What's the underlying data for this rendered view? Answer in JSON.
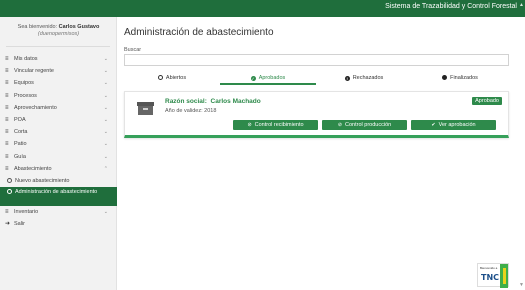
{
  "header": {
    "system_title": "Sistema de Trazabilidad y Control Forestal"
  },
  "sidebar": {
    "welcome_prefix": "Sea bienvenido: ",
    "user_name": "Carlos Gustavo",
    "username": "(duenopermisos)",
    "items": [
      {
        "label": "Mis datos"
      },
      {
        "label": "Vincular regente"
      },
      {
        "label": "Equipos"
      },
      {
        "label": "Procesos"
      },
      {
        "label": "Aprovechamiento"
      },
      {
        "label": "POA"
      },
      {
        "label": "Corta"
      },
      {
        "label": "Patio"
      },
      {
        "label": "Guía"
      },
      {
        "label": "Abastecimiento"
      },
      {
        "label": "Nuevo abastecimiento"
      },
      {
        "label": "Administración de abastecimiento"
      },
      {
        "label": "Inventario"
      },
      {
        "label": "Salir"
      }
    ]
  },
  "main": {
    "title": "Administración de abastecimiento",
    "search_label": "Buscar",
    "search_value": "",
    "tabs": [
      {
        "label": "Abiertos",
        "icon": "circle-outline-icon"
      },
      {
        "label": "Aprobados",
        "icon": "check-circle-icon"
      },
      {
        "label": "Rechazados",
        "icon": "exclamation-circle-icon"
      },
      {
        "label": "Finalizados",
        "icon": "filled-circle-icon"
      }
    ],
    "active_tab": "Aprobados",
    "card": {
      "razon_label": "Razón social:",
      "razon_value": "Carlos Machado",
      "anio_label": "Año de validez:",
      "anio_value": "2018",
      "status": "Aprobado",
      "buttons": [
        {
          "label": "Control recibimiento",
          "icon": "ban-icon"
        },
        {
          "label": "Control producción",
          "icon": "ban-icon"
        },
        {
          "label": "Ver aprobación",
          "icon": "check-icon"
        }
      ]
    }
  },
  "logo": {
    "small_text": "Bienvenido a",
    "text": "TNC"
  },
  "colors": {
    "brand_dark": "#1f6e3c",
    "accent": "#2e8a4b",
    "accent_light": "#36a05a"
  }
}
